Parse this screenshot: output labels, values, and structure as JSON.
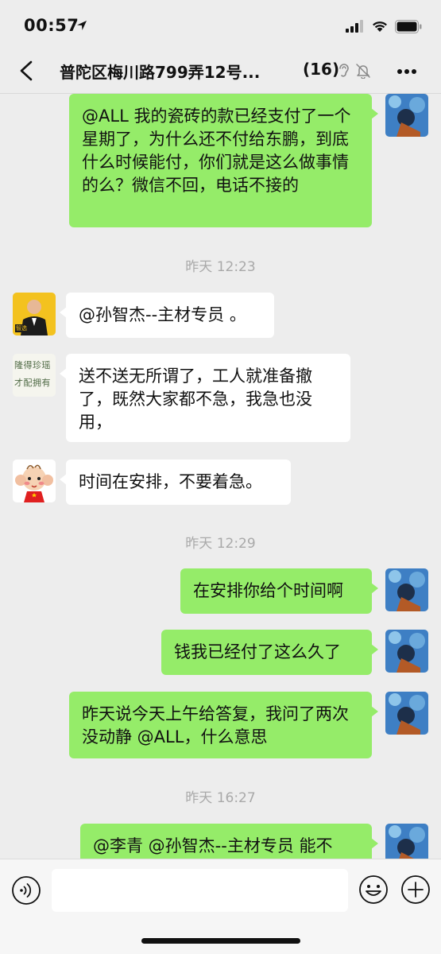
{
  "status_bar": {
    "time": "00:57"
  },
  "header": {
    "title": "普陀区梅川路799弄12号...",
    "member_count": "(16)"
  },
  "colors": {
    "outgoing_bubble": "#95ec69",
    "incoming_bubble": "#ffffff",
    "background": "#ededed"
  },
  "messages": [
    {
      "direction": "out",
      "text": "@ALL 我的瓷砖的款已经支付了一个星期了，为什么还不付给东鹏，到底什么时候能付，你们就是这么做事情的么？微信不回，电话不接的"
    },
    {
      "type": "time",
      "text": "昨天 12:23"
    },
    {
      "direction": "in",
      "text": "@孙智杰--主材专员 。"
    },
    {
      "direction": "in",
      "text": "送不送无所谓了，工人就准备撤了，既然大家都不急，我急也没用，"
    },
    {
      "direction": "in",
      "text": "时间在安排，不要着急。"
    },
    {
      "type": "time",
      "text": "昨天 12:29"
    },
    {
      "direction": "out",
      "text": "在安排你给个时间啊"
    },
    {
      "direction": "out",
      "text": "钱我已经付了这么久了"
    },
    {
      "direction": "out",
      "text": "昨天说今天上午给答复，我问了两次没动静 @ALL，什么意思"
    },
    {
      "type": "time",
      "text": "昨天 16:27"
    },
    {
      "direction": "out",
      "text": "@李青 @孙智杰--主材专员 能不"
    }
  ],
  "avatars": {
    "agent_badge": "智选",
    "calligraphy": "隆得珍瑶才配拥有"
  },
  "input": {
    "value": "",
    "placeholder": ""
  },
  "icons": {
    "back": "chevron-left-icon",
    "ear": "ear-icon",
    "mute": "bell-off-icon",
    "more": "more-dots-icon",
    "voice": "voice-icon",
    "emoji": "emoji-icon",
    "plus": "plus-icon"
  }
}
